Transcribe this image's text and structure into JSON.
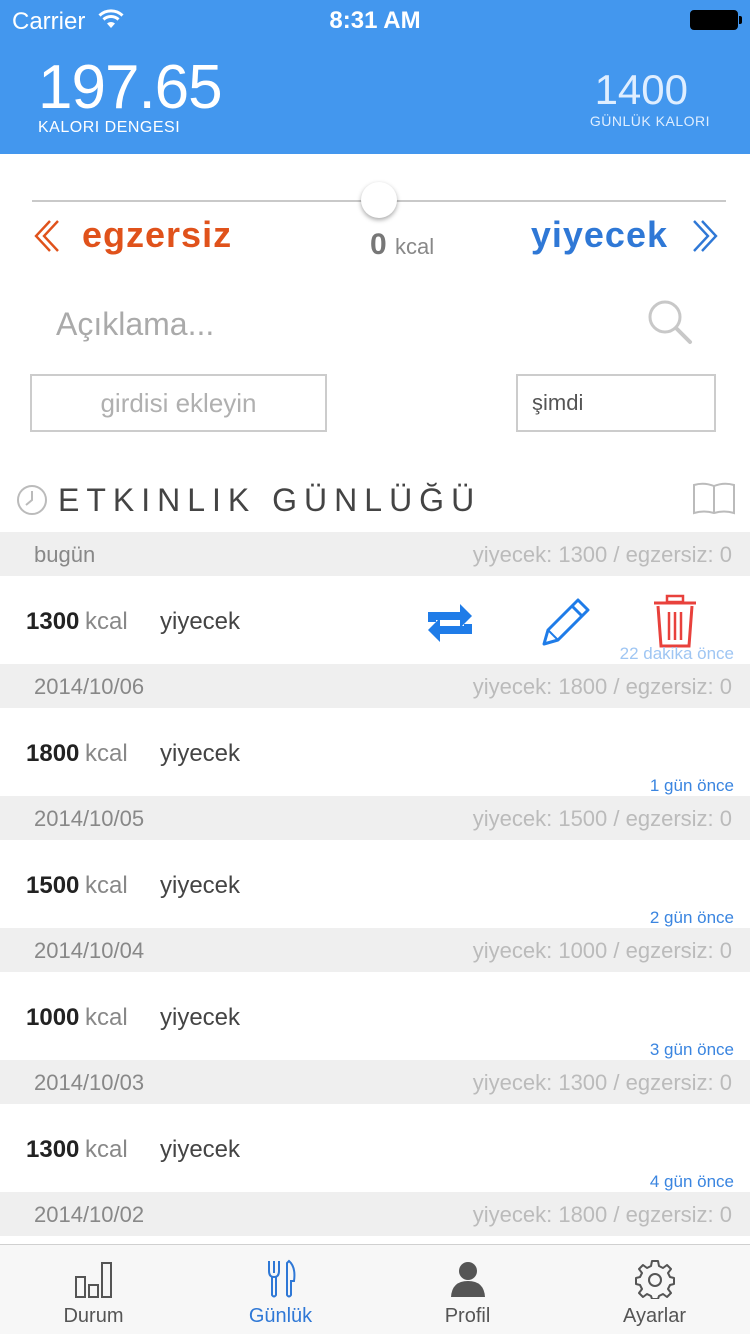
{
  "status_bar": {
    "carrier": "Carrier",
    "time": "8:31 AM"
  },
  "header": {
    "balance_value": "197.65",
    "balance_label": "KALORI DENGESI",
    "daily_value": "1400",
    "daily_label": "GÜNLÜK KALORI"
  },
  "entry_form": {
    "exercise_label": "egzersiz",
    "food_label": "yiyecek",
    "kcal_value": "0",
    "kcal_unit": "kcal",
    "slider_level": 0.5,
    "description_placeholder": "Açıklama...",
    "add_button": "girdisi ekleyin",
    "time_value": "şimdi"
  },
  "log": {
    "title": "ETKINLIK GÜNLÜĞÜ",
    "kcal_unit": "kcal",
    "days": [
      {
        "date": "bugün",
        "summary": "yiyecek: 1300 / egzersiz: 0",
        "entry": {
          "kcal": "1300",
          "type": "yiyecek",
          "ago": "22 dakika önce",
          "actions_visible": true
        }
      },
      {
        "date": "2014/10/06",
        "summary": "yiyecek: 1800 / egzersiz: 0",
        "entry": {
          "kcal": "1800",
          "type": "yiyecek",
          "ago": "1 gün önce"
        }
      },
      {
        "date": "2014/10/05",
        "summary": "yiyecek: 1500 / egzersiz: 0",
        "entry": {
          "kcal": "1500",
          "type": "yiyecek",
          "ago": "2 gün önce"
        }
      },
      {
        "date": "2014/10/04",
        "summary": "yiyecek: 1000 / egzersiz: 0",
        "entry": {
          "kcal": "1000",
          "type": "yiyecek",
          "ago": "3 gün önce"
        }
      },
      {
        "date": "2014/10/03",
        "summary": "yiyecek: 1300 / egzersiz: 0",
        "entry": {
          "kcal": "1300",
          "type": "yiyecek",
          "ago": "4 gün önce"
        }
      },
      {
        "date": "2014/10/02",
        "summary": "yiyecek: 1800 / egzersiz: 0"
      }
    ]
  },
  "tabbar": {
    "tabs": [
      {
        "label": "Durum",
        "icon": "bar-chart-icon"
      },
      {
        "label": "Günlük",
        "icon": "fork-knife-icon",
        "active": true
      },
      {
        "label": "Profil",
        "icon": "person-icon"
      },
      {
        "label": "Ayarlar",
        "icon": "gear-icon"
      }
    ]
  },
  "colors": {
    "header_bg": "#4397ee",
    "exercise": "#e0521b",
    "food": "#2f78d6",
    "delete": "#e8413c",
    "time_ago": "#3a85e0"
  }
}
